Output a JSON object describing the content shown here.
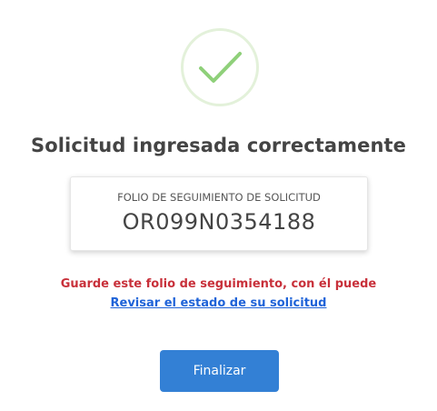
{
  "success": {
    "icon": "check-circle-icon",
    "circle_color": "#e3f1da",
    "check_color": "#8fd07a"
  },
  "title": "Solicitud ingresada correctamente",
  "folio": {
    "label": "FOLIO DE SEGUIMIENTO DE SOLICITUD",
    "number": "OR099N0354188"
  },
  "warning": {
    "text": "Guarde este folio de seguimiento, con él puede",
    "color": "#c8303a"
  },
  "status_link": {
    "label": "Revisar el estado de su solicitud",
    "color": "#1f63d8"
  },
  "finalize_button": {
    "label": "Finalizar",
    "color": "#3380d5"
  }
}
